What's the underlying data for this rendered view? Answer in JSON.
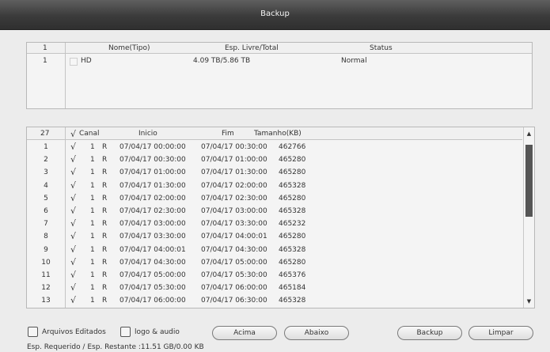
{
  "window": {
    "title": "Backup"
  },
  "device_table": {
    "count": "1",
    "headers": {
      "name": "Nome(Tipo)",
      "space": "Esp. Livre/Total",
      "status": "Status"
    },
    "rows": [
      {
        "index": "1",
        "name": "HD",
        "space": "4.09 TB/5.86 TB",
        "status": "Normal"
      }
    ]
  },
  "file_table": {
    "count": "27",
    "headers": {
      "check": "√",
      "channel": "Canal",
      "start": "Inicio",
      "end": "Fim",
      "size": "Tamanho(KB)"
    },
    "rows": [
      {
        "index": "1",
        "check": "√",
        "channel": "1",
        "type": "R",
        "start": "07/04/17 00:00:00",
        "end": "07/04/17 00:30:00",
        "size": "462766"
      },
      {
        "index": "2",
        "check": "√",
        "channel": "1",
        "type": "R",
        "start": "07/04/17 00:30:00",
        "end": "07/04/17 01:00:00",
        "size": "465280"
      },
      {
        "index": "3",
        "check": "√",
        "channel": "1",
        "type": "R",
        "start": "07/04/17 01:00:00",
        "end": "07/04/17 01:30:00",
        "size": "465280"
      },
      {
        "index": "4",
        "check": "√",
        "channel": "1",
        "type": "R",
        "start": "07/04/17 01:30:00",
        "end": "07/04/17 02:00:00",
        "size": "465328"
      },
      {
        "index": "5",
        "check": "√",
        "channel": "1",
        "type": "R",
        "start": "07/04/17 02:00:00",
        "end": "07/04/17 02:30:00",
        "size": "465280"
      },
      {
        "index": "6",
        "check": "√",
        "channel": "1",
        "type": "R",
        "start": "07/04/17 02:30:00",
        "end": "07/04/17 03:00:00",
        "size": "465328"
      },
      {
        "index": "7",
        "check": "√",
        "channel": "1",
        "type": "R",
        "start": "07/04/17 03:00:00",
        "end": "07/04/17 03:30:00",
        "size": "465232"
      },
      {
        "index": "8",
        "check": "√",
        "channel": "1",
        "type": "R",
        "start": "07/04/17 03:30:00",
        "end": "07/04/17 04:00:01",
        "size": "465280"
      },
      {
        "index": "9",
        "check": "√",
        "channel": "1",
        "type": "R",
        "start": "07/04/17 04:00:01",
        "end": "07/04/17 04:30:00",
        "size": "465328"
      },
      {
        "index": "10",
        "check": "√",
        "channel": "1",
        "type": "R",
        "start": "07/04/17 04:30:00",
        "end": "07/04/17 05:00:00",
        "size": "465280"
      },
      {
        "index": "11",
        "check": "√",
        "channel": "1",
        "type": "R",
        "start": "07/04/17 05:00:00",
        "end": "07/04/17 05:30:00",
        "size": "465376"
      },
      {
        "index": "12",
        "check": "√",
        "channel": "1",
        "type": "R",
        "start": "07/04/17 05:30:00",
        "end": "07/04/17 06:00:00",
        "size": "465184"
      },
      {
        "index": "13",
        "check": "√",
        "channel": "1",
        "type": "R",
        "start": "07/04/17 06:00:00",
        "end": "07/04/17 06:30:00",
        "size": "465328"
      }
    ]
  },
  "options": {
    "edited_files": "Arquivos Editados",
    "logo_audio": "logo & audio"
  },
  "buttons": {
    "up": "Acima",
    "down": "Abaixo",
    "backup": "Backup",
    "clear": "Limpar"
  },
  "footer": {
    "space_info": "Esp. Requerido / Esp. Restante :11.51 GB/0.00 KB"
  },
  "icons": {
    "scroll_up": "triangle-up",
    "scroll_down": "triangle-down"
  }
}
